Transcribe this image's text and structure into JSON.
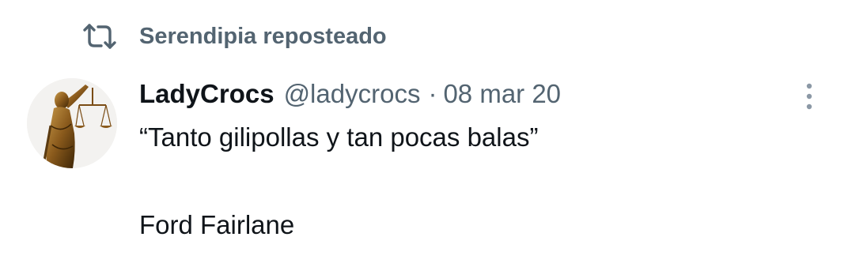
{
  "repost": {
    "icon": "repost-icon",
    "text": "Serendipia reposteado"
  },
  "tweet": {
    "avatar_icon": "lady-justice-avatar",
    "display_name": "LadyCrocs",
    "handle": "@ladycrocs",
    "separator": "·",
    "date": "08 mar 20",
    "more_icon": "more-vertical-icon",
    "lines": [
      "“Tanto gilipollas y tan pocas balas”",
      "Ford Fairlane"
    ]
  },
  "colors": {
    "primary_text": "#0f1419",
    "secondary_text": "#536471",
    "background": "#ffffff"
  }
}
